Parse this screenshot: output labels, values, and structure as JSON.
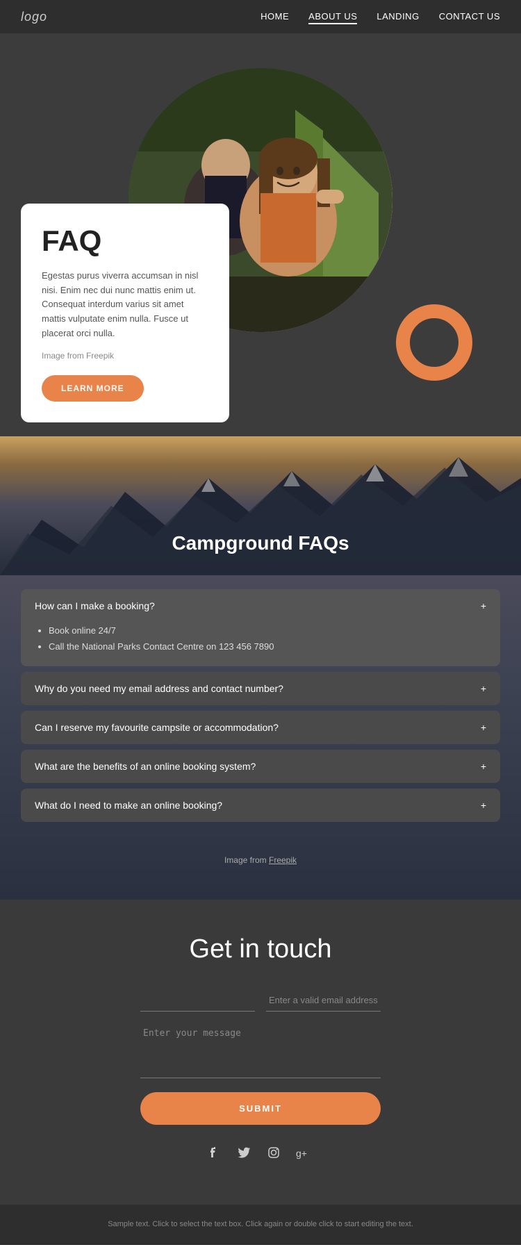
{
  "nav": {
    "logo": "logo",
    "links": [
      {
        "label": "HOME",
        "active": false
      },
      {
        "label": "ABOUT US",
        "active": true
      },
      {
        "label": "LANDING",
        "active": false
      },
      {
        "label": "CONTACT US",
        "active": false
      }
    ]
  },
  "hero": {
    "faq_title": "FAQ",
    "faq_description": "Egestas purus viverra accumsan in nisl nisi. Enim nec dui nunc mattis enim ut. Consequat interdum varius sit amet mattis vulputate enim nulla. Fusce ut placerat orci nulla.",
    "image_credit": "Image from Freepik",
    "learn_more_label": "LEARN MORE"
  },
  "campground": {
    "section_title": "Campground FAQs",
    "faqs": [
      {
        "question": "How can I make a booking?",
        "open": true,
        "answer_items": [
          "Book online 24/7",
          "Call the National Parks Contact Centre on 123 456 7890"
        ]
      },
      {
        "question": "Why do you need my email address and contact number?",
        "open": false,
        "answer_items": []
      },
      {
        "question": "Can I reserve my favourite campsite or accommodation?",
        "open": false,
        "answer_items": []
      },
      {
        "question": "What are the benefits of an online booking system?",
        "open": false,
        "answer_items": []
      },
      {
        "question": "What do I need to make an online booking?",
        "open": false,
        "answer_items": []
      }
    ],
    "image_credit_text": "Image from ",
    "image_credit_link": "Freepik"
  },
  "contact": {
    "title": "Get in touch",
    "name_placeholder": "",
    "email_placeholder": "Enter a valid email address",
    "message_placeholder": "Enter your message",
    "submit_label": "SUBMIT"
  },
  "social": {
    "icons": [
      {
        "name": "facebook-icon",
        "symbol": "f"
      },
      {
        "name": "twitter-icon",
        "symbol": "t"
      },
      {
        "name": "instagram-icon",
        "symbol": "◎"
      },
      {
        "name": "google-plus-icon",
        "symbol": "g+"
      }
    ]
  },
  "footer": {
    "text": "Sample text. Click to select the text box. Click again or double click to start editing the text."
  },
  "colors": {
    "accent": "#e8834a",
    "bg_dark": "#3a3a3a",
    "bg_darker": "#2e2e2e"
  }
}
